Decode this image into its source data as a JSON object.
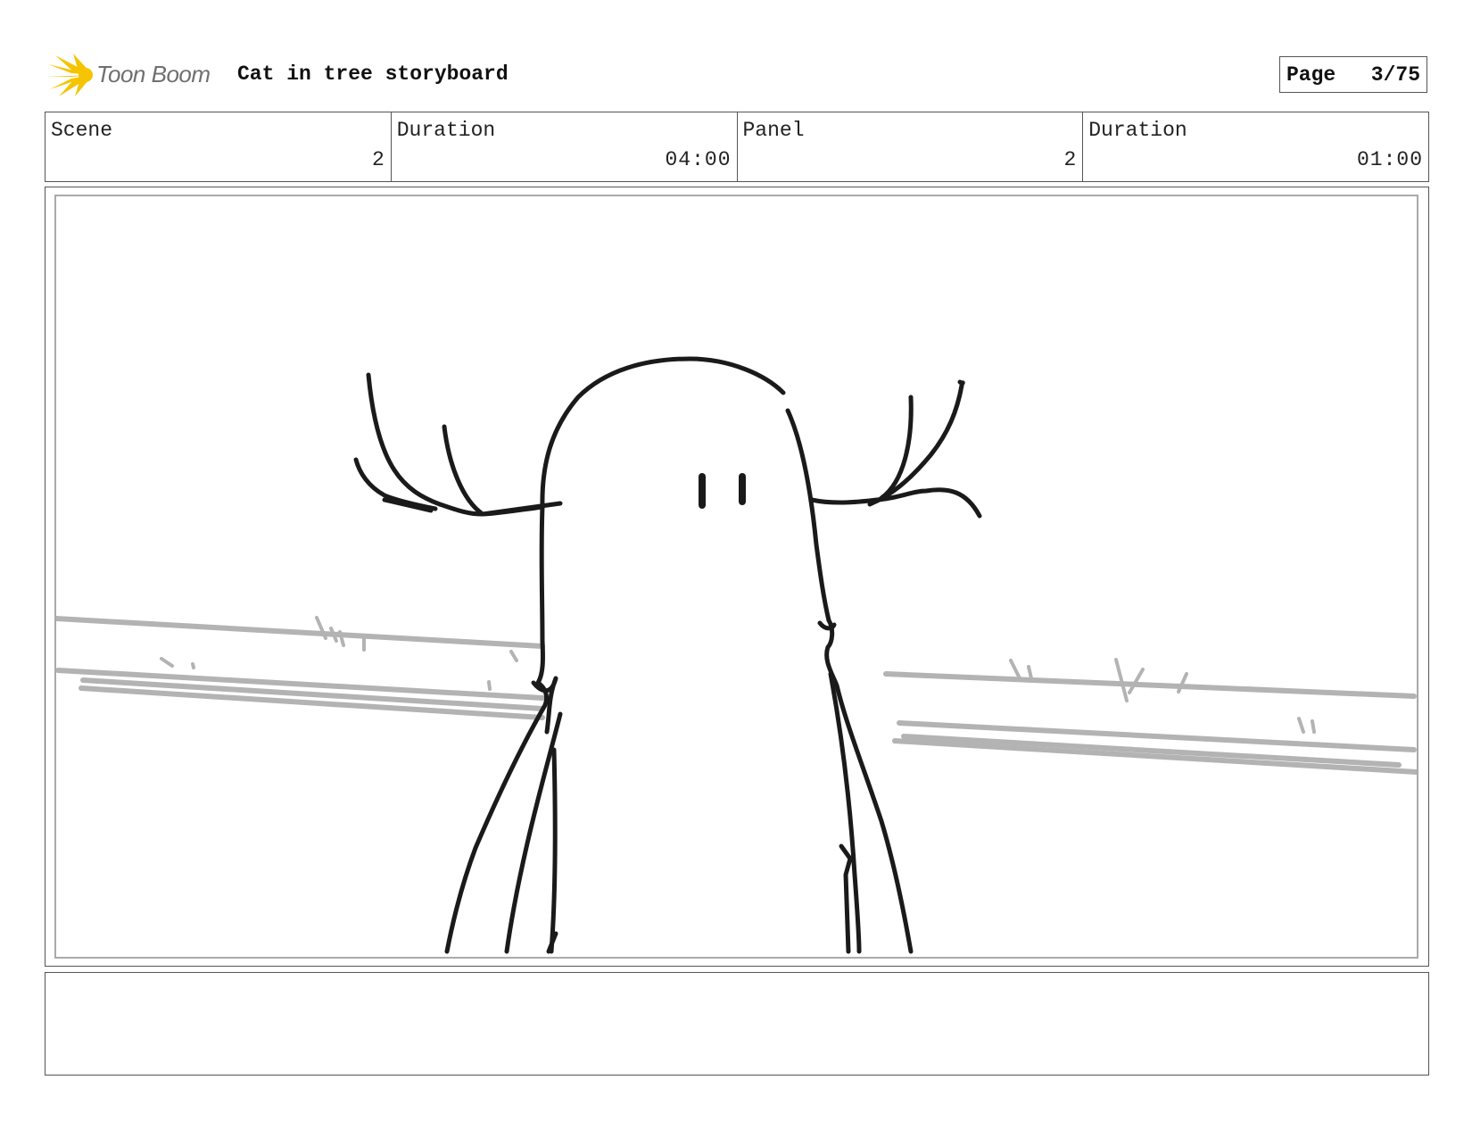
{
  "header": {
    "brand": "Toon Boom",
    "title": "Cat in tree storyboard"
  },
  "page": {
    "label": "Page",
    "value": "3/75"
  },
  "info": {
    "scene": {
      "label": "Scene",
      "value": "2"
    },
    "scene_duration": {
      "label": "Duration",
      "value": "04:00"
    },
    "panel": {
      "label": "Panel",
      "value": "2"
    },
    "panel_duration": {
      "label": "Duration",
      "value": "01:00"
    }
  },
  "caption": {
    "text": ""
  },
  "colors": {
    "logo_star": "#f5c400",
    "ink": "#1a1a1a",
    "background_lines": "#b3b3b3",
    "frame_border": "#555555"
  },
  "icons": {
    "logo": "starburst-logo-icon"
  }
}
